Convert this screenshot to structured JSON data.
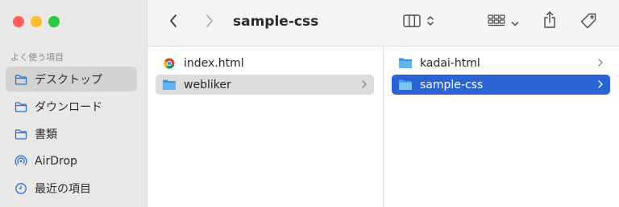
{
  "window": {
    "title": "sample-css"
  },
  "sidebar": {
    "section_title": "よく使う項目",
    "items": [
      {
        "label": "デスクトップ",
        "icon": "folder-icon",
        "selected": true
      },
      {
        "label": "ダウンロード",
        "icon": "folder-icon",
        "selected": false
      },
      {
        "label": "書類",
        "icon": "folder-icon",
        "selected": false
      },
      {
        "label": "AirDrop",
        "icon": "airdrop-icon",
        "selected": false
      },
      {
        "label": "最近の項目",
        "icon": "clock-icon",
        "selected": false
      }
    ]
  },
  "columns": [
    {
      "items": [
        {
          "name": "index.html",
          "type": "file",
          "icon": "chrome-html-file-icon"
        },
        {
          "name": "webliker",
          "type": "folder",
          "icon": "folder-icon",
          "selected": "inactive"
        }
      ]
    },
    {
      "items": [
        {
          "name": "kadai-html",
          "type": "folder",
          "icon": "folder-icon"
        },
        {
          "name": "sample-css",
          "type": "folder",
          "icon": "folder-icon",
          "selected": "active"
        }
      ]
    }
  ],
  "colors": {
    "accent": "#2a63d4",
    "sidebar_bg": "#e9e8e7",
    "toolbar_bg": "#f6f5f4",
    "folder_blue": "#4aa3e6"
  }
}
